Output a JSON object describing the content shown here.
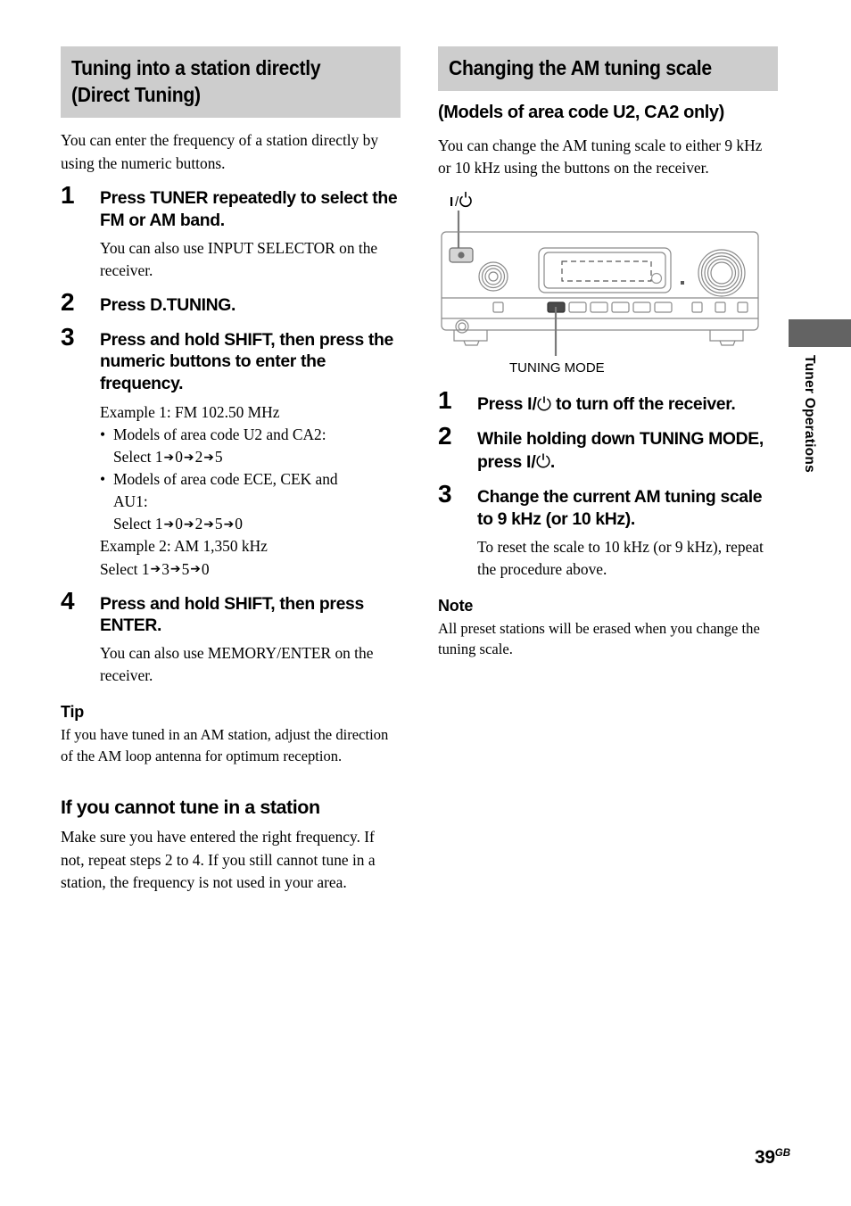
{
  "left_column": {
    "section_heading": "Tuning into a station directly\n(Direct Tuning)",
    "intro": "You can enter the frequency of a station directly by using the numeric buttons.",
    "steps": [
      {
        "num": "1",
        "title": "Press TUNER repeatedly to select the FM or AM band.",
        "body": "You can also use INPUT SELECTOR on the receiver."
      },
      {
        "num": "2",
        "title": "Press D.TUNING.",
        "body": ""
      },
      {
        "num": "3",
        "title": "Press and hold SHIFT, then press the numeric buttons to enter the frequency.",
        "body": ""
      },
      {
        "num": "4",
        "title": "Press and hold SHIFT, then press ENTER.",
        "body": "You can also use MEMORY/ENTER on the receiver."
      }
    ],
    "example": {
      "example1_label": "Example 1: FM 102.50 MHz",
      "bullet1_label": "Models of area code U2 and CA2:",
      "bullet1_select_prefix": "Select ",
      "bullet1_digits": [
        "1",
        "0",
        "2",
        "5"
      ],
      "bullet2_label": "Models of area code ECE, CEK and",
      "bullet2_label_cont": "AU1:",
      "bullet2_select_prefix": "Select ",
      "bullet2_digits": [
        "1",
        "0",
        "2",
        "5",
        "0"
      ],
      "example2_label": "Example 2: AM 1,350 kHz",
      "example2_select_prefix": "Select ",
      "example2_digits": [
        "1",
        "3",
        "5",
        "0"
      ],
      "bullet_char": "•",
      "arrow_char": "➔"
    },
    "tip": {
      "heading": "Tip",
      "body": "If you have tuned in an AM station, adjust the direction of the AM loop antenna for optimum reception."
    },
    "subsection": {
      "heading": "If you cannot tune in a station",
      "body": "Make sure you have entered the right frequency. If not, repeat steps 2 to 4. If you still cannot tune in a station, the frequency is not used in your area."
    }
  },
  "right_column": {
    "section_heading": "Changing the AM tuning scale",
    "sub_title": "(Models of area code U2, CA2 only)",
    "intro": "You can change the AM tuning scale to either 9 kHz or 10 kHz using the buttons on the receiver.",
    "diagram": {
      "power_callout": "I/⏻",
      "power_callout_bar": "I",
      "power_callout_slash": "/",
      "tuning_mode_callout": "TUNING MODE"
    },
    "steps": [
      {
        "num": "1",
        "title_pre": "Press ",
        "title_post": " to turn off the receiver.",
        "has_power_glyph": true,
        "body": ""
      },
      {
        "num": "2",
        "title_pre": "While holding down TUNING MODE, press ",
        "title_post": ".",
        "has_power_glyph": true,
        "body": ""
      },
      {
        "num": "3",
        "title_pre": "Change the current AM tuning scale to 9 kHz (or 10 kHz).",
        "title_post": "",
        "has_power_glyph": false,
        "body": "To reset the scale to 10 kHz (or 9 kHz), repeat the procedure above."
      }
    ],
    "note": {
      "heading": "Note",
      "body": "All preset stations will be erased when you change the tuning scale."
    }
  },
  "side_tab": {
    "label": "Tuner Operations"
  },
  "footer": {
    "page_number": "39",
    "page_suffix": "GB"
  },
  "colors": {
    "heading_band": "#cdcdcd",
    "side_tab": "#636363",
    "diagram_line": "#8a8a8a",
    "diagram_dark": "#4a4a4a",
    "text": "#000000"
  }
}
